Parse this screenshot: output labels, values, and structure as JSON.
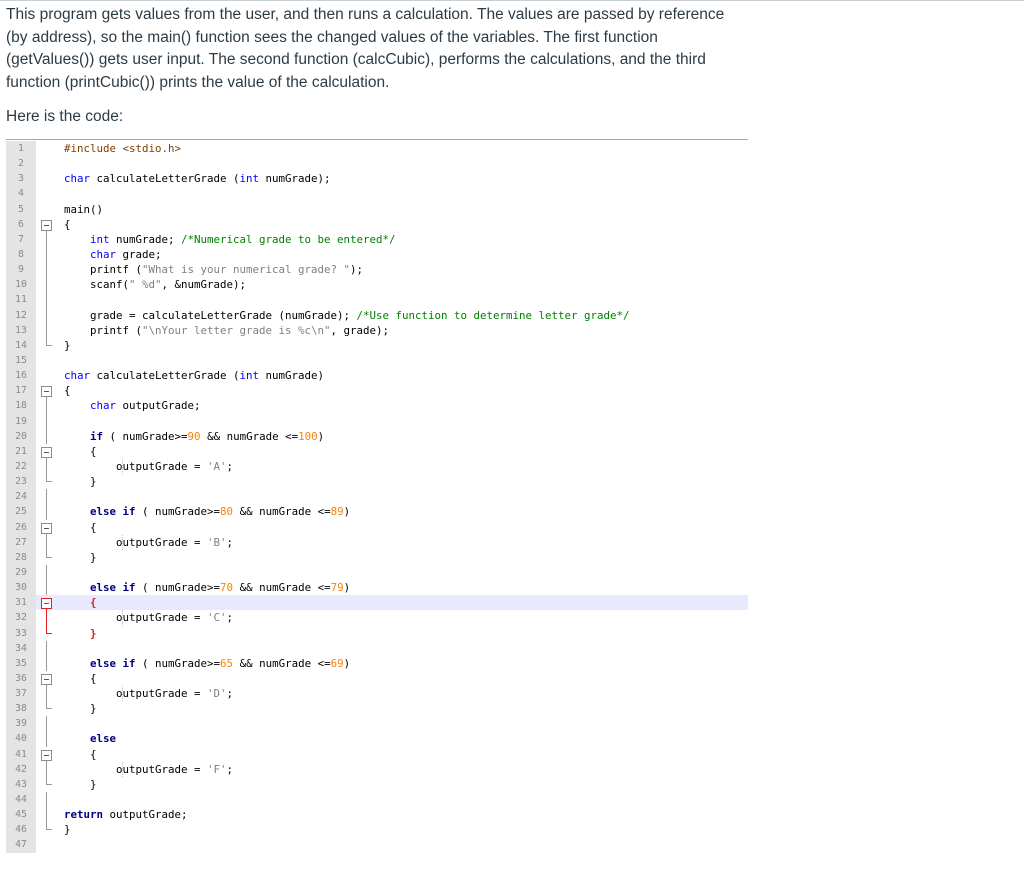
{
  "intro": {
    "paragraph": "This program gets values from the user, and then runs a calculation. The values are passed by reference (by address), so the main() function sees the changed values of the variables. The first function (getValues()) gets user input. The second function (calcCubic), performs the calculations, and the third function (printCubic()) prints the value of the calculation.",
    "lead": "Here is the code:"
  },
  "code": {
    "current_line": 31,
    "lines": [
      {
        "n": "1",
        "tokens": [
          [
            "pp",
            "#include <stdio.h>"
          ]
        ]
      },
      {
        "n": "2",
        "tokens": []
      },
      {
        "n": "3",
        "tokens": [
          [
            "kw",
            "char"
          ],
          [
            "",
            " calculateLetterGrade ("
          ],
          [
            "kw",
            "int"
          ],
          [
            "",
            " numGrade);"
          ]
        ]
      },
      {
        "n": "4",
        "tokens": []
      },
      {
        "n": "5",
        "tokens": [
          [
            "",
            "main()"
          ]
        ]
      },
      {
        "n": "6",
        "tokens": [
          [
            "",
            "{"
          ]
        ]
      },
      {
        "n": "7",
        "tokens": [
          [
            "",
            "    "
          ],
          [
            "kw",
            "int"
          ],
          [
            "",
            " numGrade; "
          ],
          [
            "cm",
            "/*Numerical grade to be entered*/"
          ]
        ]
      },
      {
        "n": "8",
        "tokens": [
          [
            "",
            "    "
          ],
          [
            "kw",
            "char"
          ],
          [
            "",
            " grade;"
          ]
        ]
      },
      {
        "n": "9",
        "tokens": [
          [
            "",
            "    printf ("
          ],
          [
            "st",
            "\"What is your numerical grade? \""
          ],
          [
            "",
            ");"
          ]
        ]
      },
      {
        "n": "10",
        "tokens": [
          [
            "",
            "    scanf("
          ],
          [
            "st",
            "\" %d\""
          ],
          [
            "",
            ", &numGrade);"
          ]
        ]
      },
      {
        "n": "11",
        "tokens": []
      },
      {
        "n": "12",
        "tokens": [
          [
            "",
            "    grade = calculateLetterGrade (numGrade); "
          ],
          [
            "cm",
            "/*Use function to determine letter grade*/"
          ]
        ]
      },
      {
        "n": "13",
        "tokens": [
          [
            "",
            "    printf ("
          ],
          [
            "st",
            "\"\\nYour letter grade is %c\\n\""
          ],
          [
            "",
            ", grade);"
          ]
        ]
      },
      {
        "n": "14",
        "tokens": [
          [
            "",
            "}"
          ]
        ]
      },
      {
        "n": "15",
        "tokens": []
      },
      {
        "n": "16",
        "tokens": [
          [
            "kw",
            "char"
          ],
          [
            "",
            " calculateLetterGrade ("
          ],
          [
            "kw",
            "int"
          ],
          [
            "",
            " numGrade)"
          ]
        ]
      },
      {
        "n": "17",
        "tokens": [
          [
            "",
            "{"
          ]
        ]
      },
      {
        "n": "18",
        "tokens": [
          [
            "",
            "    "
          ],
          [
            "kw",
            "char"
          ],
          [
            "",
            " outputGrade;"
          ]
        ]
      },
      {
        "n": "19",
        "tokens": []
      },
      {
        "n": "20",
        "tokens": [
          [
            "",
            "    "
          ],
          [
            "bk",
            "if"
          ],
          [
            "",
            " ( numGrade>="
          ],
          [
            "nm",
            "90"
          ],
          [
            "",
            " && numGrade <="
          ],
          [
            "nm",
            "100"
          ],
          [
            "",
            ")"
          ]
        ]
      },
      {
        "n": "21",
        "tokens": [
          [
            "",
            "    {"
          ]
        ]
      },
      {
        "n": "22",
        "tokens": [
          [
            "",
            "        outputGrade = "
          ],
          [
            "st",
            "'A'"
          ],
          [
            "",
            ";"
          ]
        ]
      },
      {
        "n": "23",
        "tokens": [
          [
            "",
            "    }"
          ]
        ]
      },
      {
        "n": "24",
        "tokens": []
      },
      {
        "n": "25",
        "tokens": [
          [
            "",
            "    "
          ],
          [
            "bk",
            "else if"
          ],
          [
            "",
            " ( numGrade>="
          ],
          [
            "nm",
            "80"
          ],
          [
            "",
            " && numGrade <="
          ],
          [
            "nm",
            "89"
          ],
          [
            "",
            ")"
          ]
        ]
      },
      {
        "n": "26",
        "tokens": [
          [
            "",
            "    {"
          ]
        ]
      },
      {
        "n": "27",
        "tokens": [
          [
            "",
            "        outputGrade = "
          ],
          [
            "st",
            "'B'"
          ],
          [
            "",
            ";"
          ]
        ]
      },
      {
        "n": "28",
        "tokens": [
          [
            "",
            "    }"
          ]
        ]
      },
      {
        "n": "29",
        "tokens": []
      },
      {
        "n": "30",
        "tokens": [
          [
            "",
            "    "
          ],
          [
            "bk",
            "else if"
          ],
          [
            "",
            " ( numGrade>="
          ],
          [
            "nm",
            "70"
          ],
          [
            "",
            " && numGrade <="
          ],
          [
            "nm",
            "79"
          ],
          [
            "",
            ")"
          ]
        ]
      },
      {
        "n": "31",
        "tokens": [
          [
            "",
            "    "
          ],
          [
            "br-red",
            "{"
          ]
        ]
      },
      {
        "n": "32",
        "tokens": [
          [
            "",
            "        outputGrade = "
          ],
          [
            "st",
            "'C'"
          ],
          [
            "",
            ";"
          ]
        ]
      },
      {
        "n": "33",
        "tokens": [
          [
            "",
            "    "
          ],
          [
            "br-red",
            "}"
          ]
        ]
      },
      {
        "n": "34",
        "tokens": []
      },
      {
        "n": "35",
        "tokens": [
          [
            "",
            "    "
          ],
          [
            "bk",
            "else if"
          ],
          [
            "",
            " ( numGrade>="
          ],
          [
            "nm",
            "65"
          ],
          [
            "",
            " && numGrade <="
          ],
          [
            "nm",
            "69"
          ],
          [
            "",
            ")"
          ]
        ]
      },
      {
        "n": "36",
        "tokens": [
          [
            "",
            "    {"
          ]
        ]
      },
      {
        "n": "37",
        "tokens": [
          [
            "",
            "        outputGrade = "
          ],
          [
            "st",
            "'D'"
          ],
          [
            "",
            ";"
          ]
        ]
      },
      {
        "n": "38",
        "tokens": [
          [
            "",
            "    }"
          ]
        ]
      },
      {
        "n": "39",
        "tokens": []
      },
      {
        "n": "40",
        "tokens": [
          [
            "",
            "    "
          ],
          [
            "bk",
            "else"
          ]
        ]
      },
      {
        "n": "41",
        "tokens": [
          [
            "",
            "    {"
          ]
        ]
      },
      {
        "n": "42",
        "tokens": [
          [
            "",
            "        outputGrade = "
          ],
          [
            "st",
            "'F'"
          ],
          [
            "",
            ";"
          ]
        ]
      },
      {
        "n": "43",
        "tokens": [
          [
            "",
            "    }"
          ]
        ]
      },
      {
        "n": "44",
        "tokens": []
      },
      {
        "n": "45",
        "tokens": [
          [
            "bk",
            "return"
          ],
          [
            "",
            " outputGrade;"
          ]
        ]
      },
      {
        "n": "46",
        "tokens": [
          [
            "",
            "}"
          ]
        ]
      },
      {
        "n": "47",
        "tokens": []
      }
    ]
  }
}
